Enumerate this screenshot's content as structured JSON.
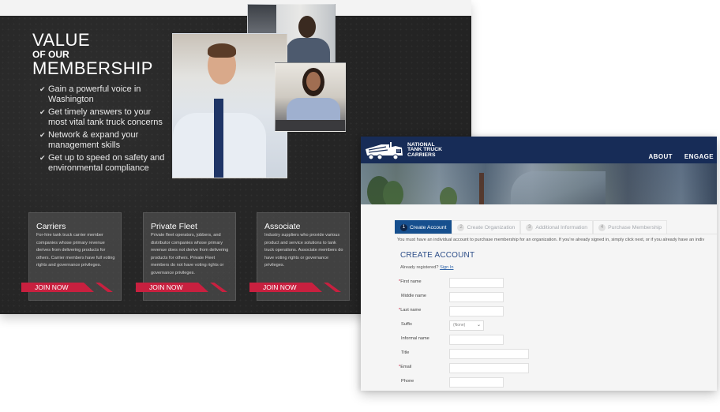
{
  "membership_page": {
    "title_line1": "VALUE",
    "title_line2": "OF OUR",
    "title_line3": "MEMBERSHIP",
    "benefits": [
      "Gain a powerful voice in Washington",
      "Get timely answers to your most vital tank truck concerns",
      "Network & expand your management skills",
      "Get up to speed on safety and environmental compliance"
    ],
    "benefit_icon": "checkmark-icon",
    "check_glyph": "✔",
    "cards": [
      {
        "title": "Carriers",
        "description": "For-hire tank truck carrier member companies whose primary revenue derives from delivering products for others. Carrier members have full voting rights and governance privileges.",
        "button": "JOIN NOW"
      },
      {
        "title": "Private Fleet",
        "description": "Private fleet operators, jobbers, and distributor companies whose primary revenue does not derive from delivering products for others. Private Fleet members do not have voting rights or governance privileges.",
        "button": "JOIN NOW"
      },
      {
        "title": "Associate",
        "description": "Industry suppliers who provide various product and service solutions to tank truck operations. Associate members do have voting rights or governance privileges.",
        "button": "JOIN NOW"
      }
    ],
    "accent_color": "#c8203f"
  },
  "registration_page": {
    "logo_text": [
      "NATIONAL",
      "TANK TRUCK",
      "CARRIERS"
    ],
    "nav": [
      "ABOUT",
      "ENGAGE"
    ],
    "steps": [
      {
        "num": "1",
        "label": "Create Account",
        "active": true
      },
      {
        "num": "2",
        "label": "Create Organization",
        "active": false
      },
      {
        "num": "3",
        "label": "Additional Information",
        "active": false
      },
      {
        "num": "4",
        "label": "Purchase Membership",
        "active": false
      }
    ],
    "notice": "You must have an individual account to purchase membership for an organization. If you're already signed in, simply click next, or if you already have an indiv",
    "form_title": "CREATE ACCOUNT",
    "already_registered": "Already registered?",
    "sign_in": "Sign In",
    "required_mark": "*",
    "fields": [
      {
        "label": "First name",
        "required": true,
        "type": "text",
        "value": ""
      },
      {
        "label": "Middle name",
        "required": false,
        "type": "text",
        "value": ""
      },
      {
        "label": "Last name",
        "required": true,
        "type": "text",
        "value": ""
      },
      {
        "label": "Suffix",
        "required": false,
        "type": "select",
        "value": "(None)"
      },
      {
        "label": "Informal name",
        "required": false,
        "type": "text",
        "value": ""
      },
      {
        "label": "Title",
        "required": false,
        "type": "text",
        "value": ""
      },
      {
        "label": "Email",
        "required": true,
        "type": "text",
        "value": ""
      },
      {
        "label": "Phone",
        "required": false,
        "type": "text",
        "value": ""
      }
    ],
    "brand_color": "#172c57",
    "active_step_color": "#164f8e"
  }
}
